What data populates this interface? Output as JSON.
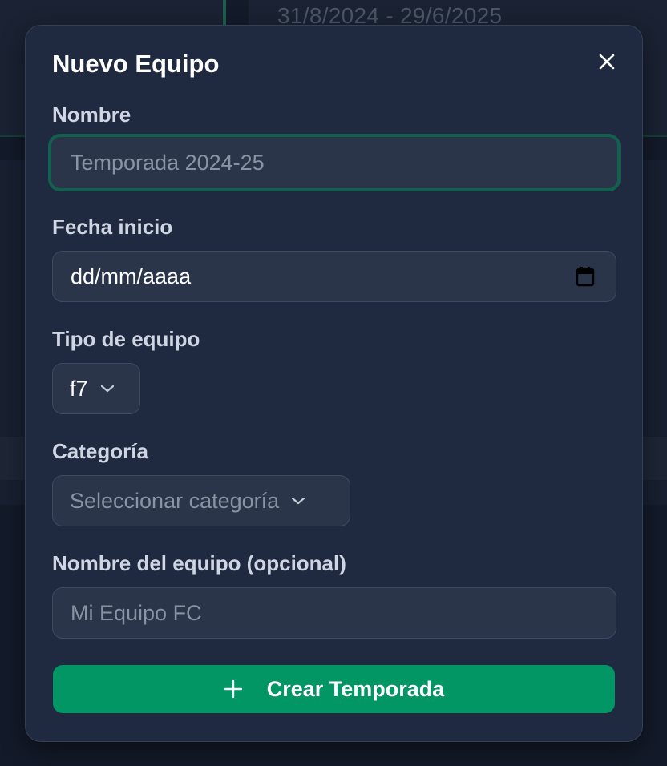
{
  "background": {
    "date_range": "31/8/2024 - 29/6/2025"
  },
  "modal": {
    "title": "Nuevo Equipo",
    "close_icon": "close-icon"
  },
  "form": {
    "nombre": {
      "label": "Nombre",
      "placeholder": "Temporada 2024-25",
      "value": ""
    },
    "fecha_inicio": {
      "label": "Fecha inicio",
      "value": "dd/mm/aaaa",
      "icon": "calendar-icon"
    },
    "tipo_equipo": {
      "label": "Tipo de equipo",
      "selected": "f7"
    },
    "categoria": {
      "label": "Categoría",
      "selected": "Seleccionar categoría"
    },
    "nombre_equipo": {
      "label": "Nombre del equipo (opcional)",
      "placeholder": "Mi Equipo FC",
      "value": ""
    }
  },
  "actions": {
    "submit_label": "Crear Temporada",
    "submit_icon": "plus-icon"
  },
  "colors": {
    "primary": "#019663",
    "focus_ring": "#12604d",
    "modal_bg": "#1f2940",
    "field_bg": "#2a3549"
  }
}
